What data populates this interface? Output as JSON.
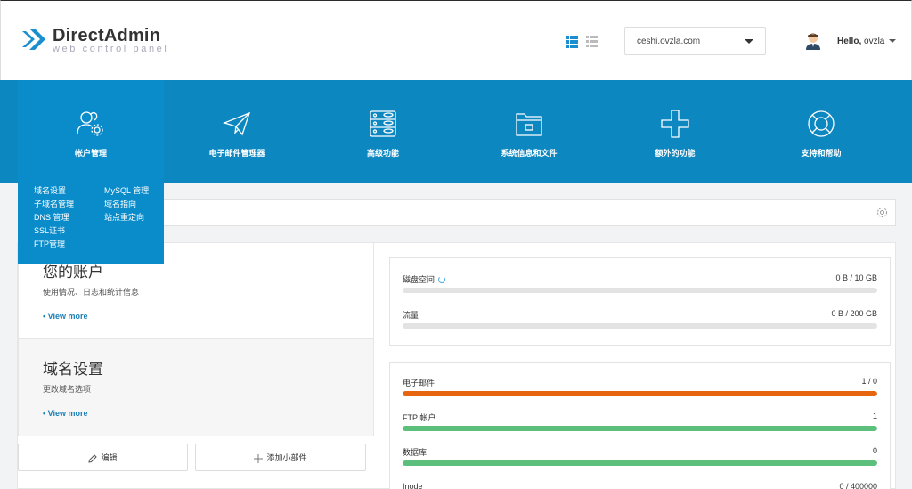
{
  "header": {
    "brand": "DirectAdmin",
    "brand_sub": "web control panel",
    "domain_selected": "ceshi.ovzla.com",
    "greeting": "Hello,",
    "username": "ovzla"
  },
  "nav": {
    "items": [
      {
        "label": "帐户管理",
        "icon": "users-gear-icon"
      },
      {
        "label": "电子邮件管理器",
        "icon": "paper-plane-icon"
      },
      {
        "label": "高级功能",
        "icon": "server-database-icon"
      },
      {
        "label": "系统信息和文件",
        "icon": "folder-icon"
      },
      {
        "label": "额外的功能",
        "icon": "plus-icon"
      },
      {
        "label": "支持和帮助",
        "icon": "lifebuoy-icon"
      }
    ]
  },
  "dropdown": {
    "col1": [
      "域名设置",
      "子域名管理",
      "DNS 管理",
      "SSL证书",
      "FTP管理"
    ],
    "col2": [
      "MySQL 管理",
      "域名指向",
      "站点重定向"
    ]
  },
  "cards": [
    {
      "title": "您的账户",
      "desc": "使用情况、日志和统计信息",
      "more": "• View more"
    },
    {
      "title": "域名设置",
      "desc": "更改域名选项",
      "more": "• View more"
    }
  ],
  "buttons": {
    "edit": "编辑",
    "add_widget": "添加小部件"
  },
  "stats_top": [
    {
      "name": "磁盘空间",
      "value": "0 B / 10 GB",
      "fill": 0,
      "color": "#e3e3e3"
    },
    {
      "name": "流量",
      "value": "0 B / 200 GB",
      "fill": 0,
      "color": "#e3e3e3"
    }
  ],
  "stats_bottom": [
    {
      "name": "电子邮件",
      "value": "1 / 0",
      "fill": 1,
      "color": "#e8650f"
    },
    {
      "name": "FTP 帐户",
      "value": "1",
      "fill": 1,
      "color": "#5cbf7c"
    },
    {
      "name": "数据库",
      "value": "0",
      "fill": 1,
      "color": "#5cbf7c"
    },
    {
      "name": "Inode",
      "value": "0 / 400000",
      "fill": 0,
      "color": "#e3e3e3"
    }
  ],
  "colors": {
    "nav_bg": "#0d87c0",
    "accent": "#1a7fb5"
  }
}
